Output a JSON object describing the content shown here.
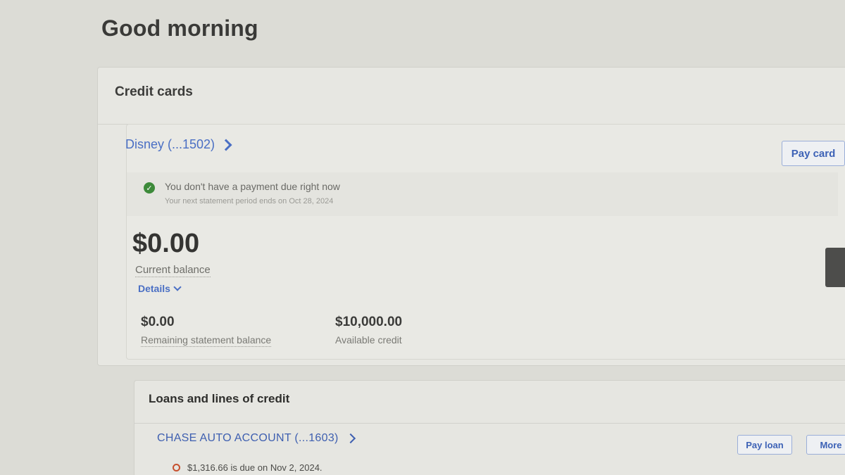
{
  "greeting": "Good morning",
  "credit_cards": {
    "header": "Credit cards",
    "card": {
      "name": "Disney (...1502)",
      "pay_button": "Pay card",
      "notice": {
        "message": "You don't have a payment due right now",
        "subtext": "Your next statement period ends on Oct 28, 2024"
      },
      "current_balance": "$0.00",
      "current_balance_label": "Current balance",
      "details_label": "Details",
      "remaining_statement_balance": "$0.00",
      "remaining_statement_balance_label": "Remaining statement balance",
      "available_credit": "$10,000.00",
      "available_credit_label": "Available credit"
    }
  },
  "loans": {
    "header": "Loans and lines of credit",
    "account": {
      "name": "CHASE AUTO ACCOUNT (...1603)",
      "pay_button": "Pay loan",
      "more_button": "More",
      "due_message": "$1,316.66 is due on Nov 2, 2024."
    }
  },
  "colors": {
    "link": "#4a6fc4",
    "success": "#3d8a3a",
    "warning": "#c7502e"
  }
}
